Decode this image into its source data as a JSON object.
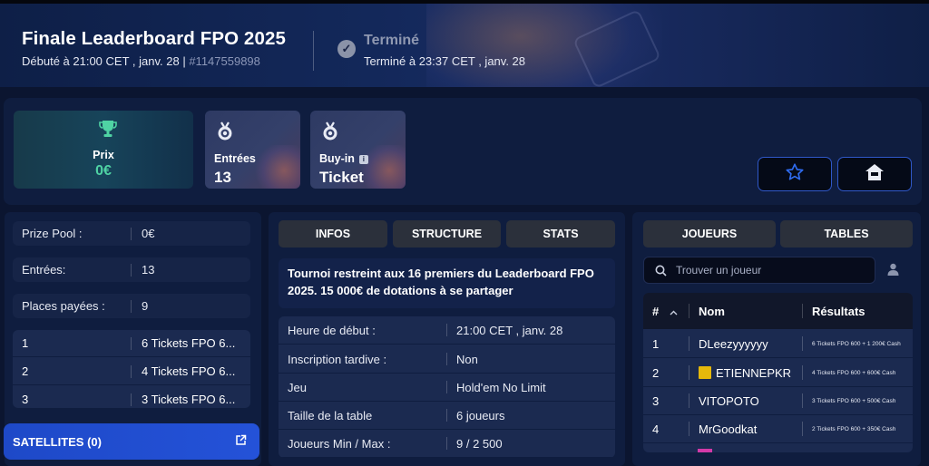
{
  "header": {
    "title": "Finale Leaderboard FPO 2025",
    "started": "Débuté à 21:00 CET , janv. 28",
    "separator": "|",
    "tournament_id": "#1147559898",
    "status_title": "Terminé",
    "status_sub": "Terminé à 23:37 CET , janv. 28"
  },
  "cards": {
    "prix": {
      "label": "Prix",
      "value": "0€",
      "icon": "trophy-icon"
    },
    "entrees": {
      "label": "Entrées",
      "value": "13",
      "icon": "medal-icon"
    },
    "buyin": {
      "label": "Buy-in",
      "value": "Ticket",
      "badge": "i",
      "icon": "medal-icon"
    }
  },
  "actions": {
    "favorite_icon": "star-icon",
    "home_icon": "home-icon"
  },
  "summary": {
    "rows": [
      {
        "label": "Prize Pool :",
        "value": "0€"
      },
      {
        "label": "Entrées:",
        "value": "13"
      },
      {
        "label": "Places payées :",
        "value": "9"
      }
    ],
    "payouts": [
      {
        "place": "1",
        "prize": "6 Tickets FPO 6..."
      },
      {
        "place": "2",
        "prize": "4 Tickets FPO 6..."
      },
      {
        "place": "3",
        "prize": "3 Tickets FPO 6..."
      }
    ],
    "satellites_label": "SATELLITES (0)"
  },
  "info_tabs": [
    "INFOS",
    "STRUCTURE",
    "STATS"
  ],
  "description": "Tournoi restreint aux 16 premiers du Leaderboard FPO 2025. 15 000€ de dotations à se partager",
  "info_rows": [
    {
      "label": "Heure de début :",
      "value": "21:00 CET , janv. 28"
    },
    {
      "label": "Inscription tardive :",
      "value": "Non"
    },
    {
      "label": "Jeu",
      "value": "Hold'em No Limit"
    },
    {
      "label": "Taille de la table",
      "value": "6 joueurs"
    },
    {
      "label": "Joueurs Min / Max :",
      "value": "9 / 2 500"
    }
  ],
  "player_tabs": [
    "JOUEURS",
    "TABLES"
  ],
  "search": {
    "placeholder": "Trouver un joueur"
  },
  "players_table": {
    "headers": {
      "rank": "#",
      "name": "Nom",
      "result": "Résultats"
    },
    "rows": [
      {
        "rank": "1",
        "name": "DLeezyyyyyy",
        "result": "6 Tickets FPO 600 + 1 200€ Cash",
        "flag": false
      },
      {
        "rank": "2",
        "name": "ETIENNEPKR",
        "result": "4 Tickets FPO 600 + 600€ Cash",
        "flag": true
      },
      {
        "rank": "3",
        "name": "VITOPOTO",
        "result": "3 Tickets FPO 600 + 500€ Cash",
        "flag": false
      },
      {
        "rank": "4",
        "name": "MrGoodkat",
        "result": "2 Tickets FPO 600 + 350€ Cash",
        "flag": false
      }
    ]
  },
  "colors": {
    "accent": "#2452d8",
    "prize": "#4fd3a4",
    "background": "#0b1530"
  }
}
